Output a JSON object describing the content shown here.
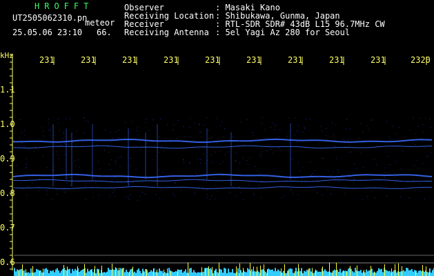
{
  "header": {
    "app_name": "HROFFT",
    "filename": "UT2505062310.pn",
    "meteor_label": "meteor",
    "datetime": "25.05.06 23:10",
    "count": "66."
  },
  "info": {
    "labels": [
      "Observer",
      "Receiving Location",
      "Receiver",
      "Receiving Antenna"
    ],
    "values": [
      ": Masaki Kano",
      ": Shibukawa, Gunma, Japan",
      ": RTL-SDR SDR# 43dB L15 96.7MHz CW",
      ": 5el Yagi Az 280 for Seoul"
    ]
  },
  "axis": {
    "unit": "kHz",
    "time_ticks": [
      "231",
      "231",
      "231",
      "231",
      "231",
      "231",
      "231",
      "231",
      "231",
      "2320"
    ],
    "freq_ticks": [
      "1.1",
      "1.0",
      "0.9",
      "0.8",
      "0.7",
      "0.6"
    ]
  },
  "colors": {
    "background": "#000000",
    "grid_tick": "#ffff66",
    "signal": "#3a6bff",
    "meteor_bar": "#ffff33",
    "noise_bar": "#33ccff",
    "text": "#ffffff",
    "title": "#33ff66"
  }
}
